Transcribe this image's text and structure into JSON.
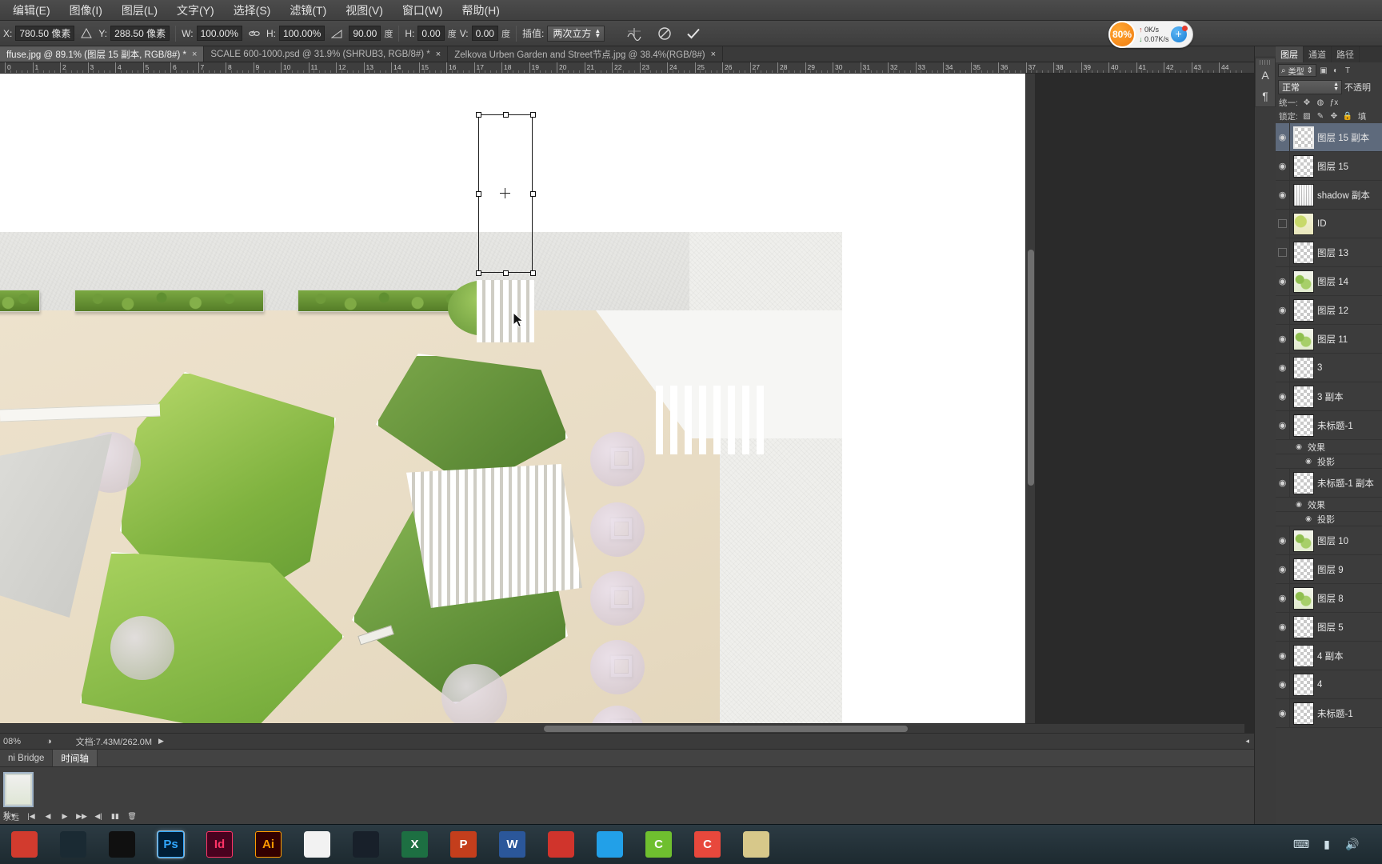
{
  "menubar": {
    "items": [
      {
        "label": "编辑(E)"
      },
      {
        "label": "图像(I)"
      },
      {
        "label": "图层(L)"
      },
      {
        "label": "文字(Y)"
      },
      {
        "label": "选择(S)"
      },
      {
        "label": "滤镜(T)"
      },
      {
        "label": "视图(V)"
      },
      {
        "label": "窗口(W)"
      },
      {
        "label": "帮助(H)"
      }
    ]
  },
  "options_bar": {
    "x_label": "X:",
    "x_value": "780.50 像素",
    "y_label": "Y:",
    "y_value": "288.50 像素",
    "w_label": "W:",
    "w_value": "100.00%",
    "h_label": "H:",
    "h_value": "100.00%",
    "angle_value": "90.00",
    "angle_unit": "度",
    "skew_h_label": "H:",
    "skew_h_value": "0.00",
    "skew_h_unit": "度",
    "skew_v_label": "V:",
    "skew_v_value": "0.00",
    "skew_v_unit": "度",
    "interp_label": "插值:",
    "interp_value": "两次立方",
    "icons": {
      "warp": "warp-icon",
      "cancel": "cancel-transform-icon",
      "commit": "commit-transform-icon",
      "link": "link-wh-icon",
      "ref_point": "reference-point-icon"
    }
  },
  "net_widget": {
    "percent": "80%",
    "upload": "0K/s",
    "download": "0.07K/s",
    "plus": "+"
  },
  "doc_tabs": [
    {
      "label": "ffuse.jpg @ 89.1% (图层 15 副本, RGB/8#) *",
      "active": true,
      "close": "×"
    },
    {
      "label": "SCALE 600-1000.psd @ 31.9% (SHRUB3, RGB/8#) *",
      "active": false,
      "close": "×"
    },
    {
      "label": "Zelkova Urben Garden and Street节点.jpg @ 38.4%(RGB/8#)",
      "active": false,
      "close": "×"
    }
  ],
  "ruler": {
    "labels": [
      "0",
      "1",
      "2",
      "3",
      "4",
      "5",
      "6",
      "7",
      "8",
      "9",
      "10",
      "11",
      "12",
      "13",
      "14",
      "15",
      "16",
      "17",
      "18",
      "19",
      "20",
      "21",
      "22",
      "23",
      "24",
      "25",
      "26",
      "27",
      "28",
      "29",
      "30",
      "31",
      "32",
      "33",
      "34",
      "35",
      "36",
      "37",
      "38",
      "39",
      "40",
      "41",
      "42",
      "43",
      "44"
    ]
  },
  "status_bar": {
    "zoom": "08%",
    "doc_label": "文档:7.43M/262.0M",
    "arrow": "▶"
  },
  "dock_tabs": [
    {
      "label": "ni Bridge",
      "active": false
    },
    {
      "label": "时间轴",
      "active": true
    }
  ],
  "timeline": {
    "frame_label": "秒",
    "dropdown": "▾",
    "loop_label": "永远",
    "buttons": [
      "|◀",
      "◀",
      "▶",
      "▶▶",
      "◀|",
      "▮▮",
      "🗑"
    ]
  },
  "right_dock": {
    "collapse": "◄◄",
    "mini_rail": [
      {
        "name": "character-panel-icon",
        "glyph": "A"
      },
      {
        "name": "paragraph-panel-icon",
        "glyph": "¶"
      }
    ],
    "panel_tabs": [
      {
        "label": "图层",
        "active": true
      },
      {
        "label": "通道",
        "active": false
      },
      {
        "label": "路径",
        "active": false
      }
    ],
    "filter": {
      "search_glyph": "⌕",
      "kind_label": "类型",
      "arrows": "⇕",
      "icons": [
        "pixel-filter-icon",
        "adjustment-filter-icon",
        "type-filter-icon",
        "shape-filter-icon",
        "smart-filter-icon"
      ]
    },
    "blend_mode": "正常",
    "opacity_label": "不透明",
    "unify_label": "统一:",
    "unify_icons": [
      "unify-position-icon",
      "unify-visibility-icon",
      "unify-style-icon"
    ],
    "lock_label": "锁定:",
    "lock_icons": [
      "lock-transparency-icon",
      "lock-image-icon",
      "lock-position-icon",
      "lock-all-icon"
    ],
    "fill_label": "填"
  },
  "layers": [
    {
      "name": "图层 15 副本",
      "visible": true,
      "selected": true,
      "thumb": "transparent",
      "fx": []
    },
    {
      "name": "图层 15",
      "visible": true,
      "selected": false,
      "thumb": "transparent",
      "fx": []
    },
    {
      "name": "shadow 副本",
      "visible": true,
      "selected": false,
      "thumb": "shadow",
      "fx": []
    },
    {
      "name": "ID",
      "visible": false,
      "selected": false,
      "thumb": "id",
      "fx": []
    },
    {
      "name": "图层 13",
      "visible": false,
      "selected": false,
      "thumb": "transparent",
      "fx": []
    },
    {
      "name": "图层 14",
      "visible": true,
      "selected": false,
      "thumb": "green",
      "fx": []
    },
    {
      "name": "图层 12",
      "visible": true,
      "selected": false,
      "thumb": "transparent",
      "fx": []
    },
    {
      "name": "图层 11",
      "visible": true,
      "selected": false,
      "thumb": "green",
      "fx": []
    },
    {
      "name": "3",
      "visible": true,
      "selected": false,
      "thumb": "transparent",
      "fx": []
    },
    {
      "name": "3 副本",
      "visible": true,
      "selected": false,
      "thumb": "transparent",
      "fx": []
    },
    {
      "name": "未标题-1",
      "visible": true,
      "selected": false,
      "thumb": "transparent",
      "fx": [
        "效果",
        "投影"
      ]
    },
    {
      "name": "未标题-1 副本",
      "visible": true,
      "selected": false,
      "thumb": "transparent",
      "fx": [
        "效果",
        "投影"
      ]
    },
    {
      "name": "图层 10",
      "visible": true,
      "selected": false,
      "thumb": "green",
      "fx": []
    },
    {
      "name": "图层 9",
      "visible": true,
      "selected": false,
      "thumb": "transparent",
      "fx": []
    },
    {
      "name": "图层 8",
      "visible": true,
      "selected": false,
      "thumb": "green",
      "fx": []
    },
    {
      "name": "图层 5",
      "visible": true,
      "selected": false,
      "thumb": "transparent",
      "fx": []
    },
    {
      "name": "4 副本",
      "visible": true,
      "selected": false,
      "thumb": "transparent",
      "fx": []
    },
    {
      "name": "4",
      "visible": true,
      "selected": false,
      "thumb": "transparent",
      "fx": []
    },
    {
      "name": "未标题-1",
      "visible": true,
      "selected": false,
      "thumb": "transparent",
      "fx": []
    }
  ],
  "taskbar": {
    "icons": [
      {
        "name": "app-red-icon",
        "label": "",
        "color": "#d23b2e"
      },
      {
        "name": "app-willow-icon",
        "label": "",
        "color": "#1a2a33"
      },
      {
        "name": "app-star-icon",
        "label": "",
        "color": "#101010"
      },
      {
        "name": "photoshop-icon",
        "label": "Ps",
        "color": "#001e36"
      },
      {
        "name": "indesign-icon",
        "label": "Id",
        "color": "#49021f"
      },
      {
        "name": "illustrator-icon",
        "label": "Ai",
        "color": "#330000"
      },
      {
        "name": "app-bird-icon",
        "label": "",
        "color": "#f2f2f2"
      },
      {
        "name": "qq-penguin-icon",
        "label": "",
        "color": "#18202a"
      },
      {
        "name": "excel-icon",
        "label": "X",
        "color": "#1d6f42"
      },
      {
        "name": "powerpoint-icon",
        "label": "P",
        "color": "#c43e1c"
      },
      {
        "name": "word-icon",
        "label": "W",
        "color": "#2b579a"
      },
      {
        "name": "pdf-icon",
        "label": "",
        "color": "#d0342c"
      },
      {
        "name": "cloud-icon",
        "label": "",
        "color": "#22a0e8"
      },
      {
        "name": "wechat-icon",
        "label": "C",
        "color": "#6fbf2f"
      },
      {
        "name": "app-c-red-icon",
        "label": "C",
        "color": "#e8483c"
      },
      {
        "name": "explorer-icon",
        "label": "",
        "color": "#d7c88a"
      }
    ],
    "tray": {
      "icons": [
        "keyboard-icon",
        "network-icon",
        "volume-icon",
        "battery-icon"
      ],
      "time": "",
      "date": ""
    }
  },
  "canvas": {
    "selection": {
      "x_label": "selection-bounding-box",
      "handles": 8
    },
    "cursor": "move-cursor"
  }
}
